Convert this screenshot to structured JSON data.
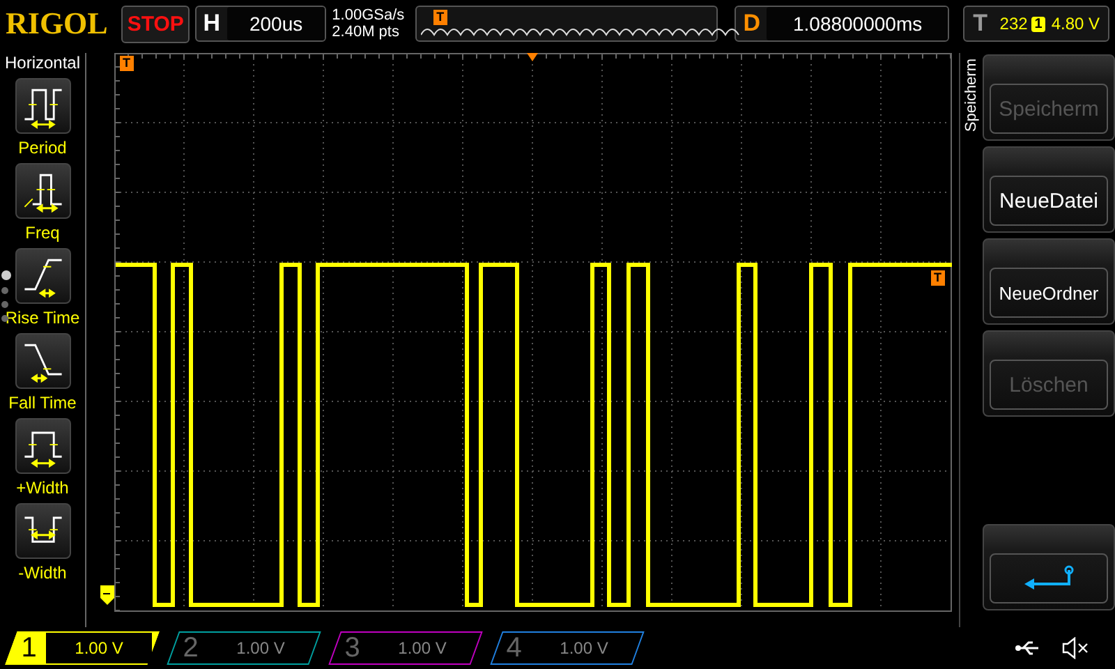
{
  "top_bar": {
    "logo": "RIGOL",
    "run_state": "STOP",
    "horizontal": {
      "label": "H",
      "timebase": "200us"
    },
    "sample_rate": "1.00GSa/s",
    "memory_depth": "2.40M pts",
    "trigger_marker": "T",
    "delay": {
      "label": "D",
      "value": "1.08800000ms"
    },
    "trigger": {
      "label": "T",
      "level_code": "232",
      "source": "1",
      "level": "4.80 V"
    }
  },
  "measure_menu": {
    "title": "Horizontal",
    "items": [
      {
        "label": "Period",
        "kind": "period"
      },
      {
        "label": "Freq",
        "kind": "freq"
      },
      {
        "label": "Rise Time",
        "kind": "rise"
      },
      {
        "label": "Fall Time",
        "kind": "fall"
      },
      {
        "label": "+Width",
        "kind": "pwidth"
      },
      {
        "label": "-Width",
        "kind": "nwidth"
      }
    ],
    "pages": [
      {
        "selected": true
      },
      {
        "selected": false
      },
      {
        "selected": false
      },
      {
        "selected": false
      }
    ]
  },
  "graticule": {
    "trigger_position_marker": "T",
    "trigger_level_marker": "T"
  },
  "side_menu": {
    "title": "Speicherm",
    "buttons": [
      {
        "label": "Speicherm",
        "disabled": true
      },
      {
        "label": "NeueDatei",
        "disabled": false
      },
      {
        "label": "NeueOrdner",
        "disabled": false
      },
      {
        "label": "Löschen",
        "disabled": true
      }
    ]
  },
  "channels": [
    {
      "number": "1",
      "scale": "1.00 V",
      "on": true,
      "color": "#ffff00"
    },
    {
      "number": "2",
      "scale": "1.00 V",
      "on": false,
      "color": "#00a0a0"
    },
    {
      "number": "3",
      "scale": "1.00 V",
      "on": false,
      "color": "#c000c0"
    },
    {
      "number": "4",
      "scale": "1.00 V",
      "on": false,
      "color": "#2080e0"
    }
  ]
}
